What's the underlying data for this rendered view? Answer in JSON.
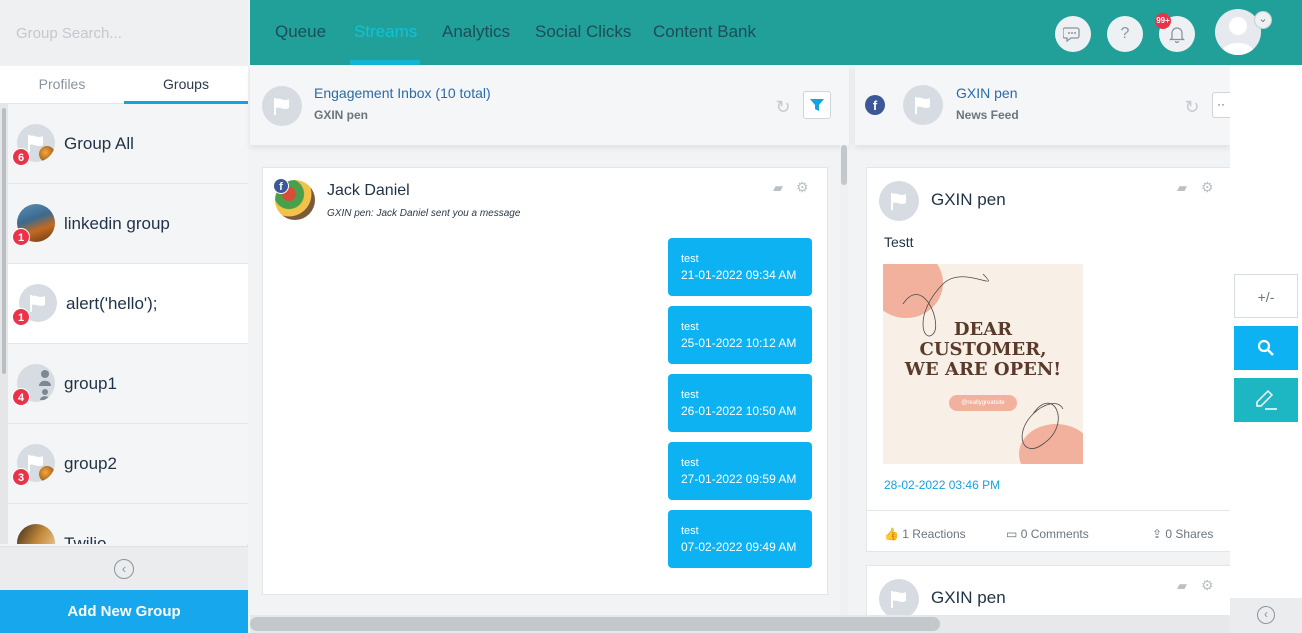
{
  "sidebar": {
    "search_placeholder": "Group Search...",
    "tabs": [
      "Profiles",
      "Groups"
    ],
    "groups": [
      {
        "label": "Group All",
        "badge": "6"
      },
      {
        "label": "linkedin group",
        "badge": "1"
      },
      {
        "label": "alert('hello');",
        "badge": "1"
      },
      {
        "label": "group1",
        "badge": "4"
      },
      {
        "label": "group2",
        "badge": "3"
      },
      {
        "label": "Twilio",
        "badge": ""
      }
    ],
    "add_button": "Add New Group"
  },
  "nav": {
    "tabs": [
      "Queue",
      "Streams",
      "Analytics",
      "Social Clicks",
      "Content Bank"
    ],
    "active_tab": "Streams",
    "notif_count": "99+"
  },
  "stream1": {
    "title": "Engagement Inbox (10 total)",
    "subtitle": "GXIN pen",
    "sender": "Jack Daniel",
    "preview": "GXIN pen: Jack Daniel sent you a message",
    "messages": [
      {
        "text": "test",
        "time": "21-01-2022 09:34 AM"
      },
      {
        "text": "test",
        "time": "25-01-2022 10:12 AM"
      },
      {
        "text": "test",
        "time": "26-01-2022 10:50 AM"
      },
      {
        "text": "test",
        "time": "27-01-2022 09:59 AM"
      },
      {
        "text": "test",
        "time": "07-02-2022 09:49 AM"
      }
    ]
  },
  "stream2": {
    "title": "GXIN pen",
    "subtitle": "News Feed",
    "post": {
      "author": "GXIN pen",
      "text": "Testt",
      "image_line1": "DEAR",
      "image_line2": "CUSTOMER,",
      "image_line3": "WE ARE OPEN!",
      "image_tag": "@reallygreatsite",
      "time": "28-02-2022 03:46 PM",
      "reactions": "1 Reactions",
      "comments": "0 Comments",
      "shares": "0 Shares"
    },
    "post2_author": "GXIN pen"
  },
  "side_actions": {
    "expand_label": "+/-"
  },
  "colors": {
    "nav_bg": "#21a09a",
    "accent_blue": "#16a7ec",
    "teal_button": "#1db7c4",
    "badge_red": "#e8334a"
  }
}
